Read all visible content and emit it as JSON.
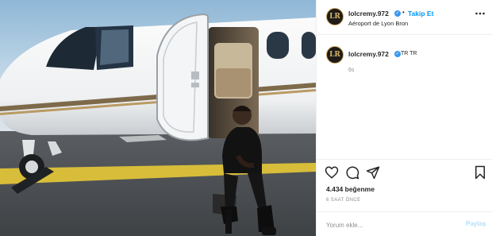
{
  "post": {
    "username": "lolcremy.972",
    "follow_label": "Takip Et",
    "separator": "•",
    "location": "Aéroport de Lyon Bron",
    "more_icon": "more-horizontal-icon",
    "avatar_letters": "LR",
    "verified_mark": "✓"
  },
  "caption": {
    "username": "lolcremy.972",
    "text": "TR TR",
    "time_ago": "6s"
  },
  "actions": {
    "icons": [
      "heart-icon",
      "comment-icon",
      "share-icon",
      "bookmark-icon"
    ]
  },
  "stats": {
    "likes_text": "4.434 beğenme",
    "date_text": "6 SAAT ÖNCE"
  },
  "comment": {
    "placeholder": "Yorum ekle...",
    "post_label": "Paylaş"
  },
  "colors": {
    "accent_blue": "#0095f6",
    "verified_blue": "#3897f0",
    "post_disabled": "#b2dffc",
    "muted_gray": "#8e8e8e"
  }
}
